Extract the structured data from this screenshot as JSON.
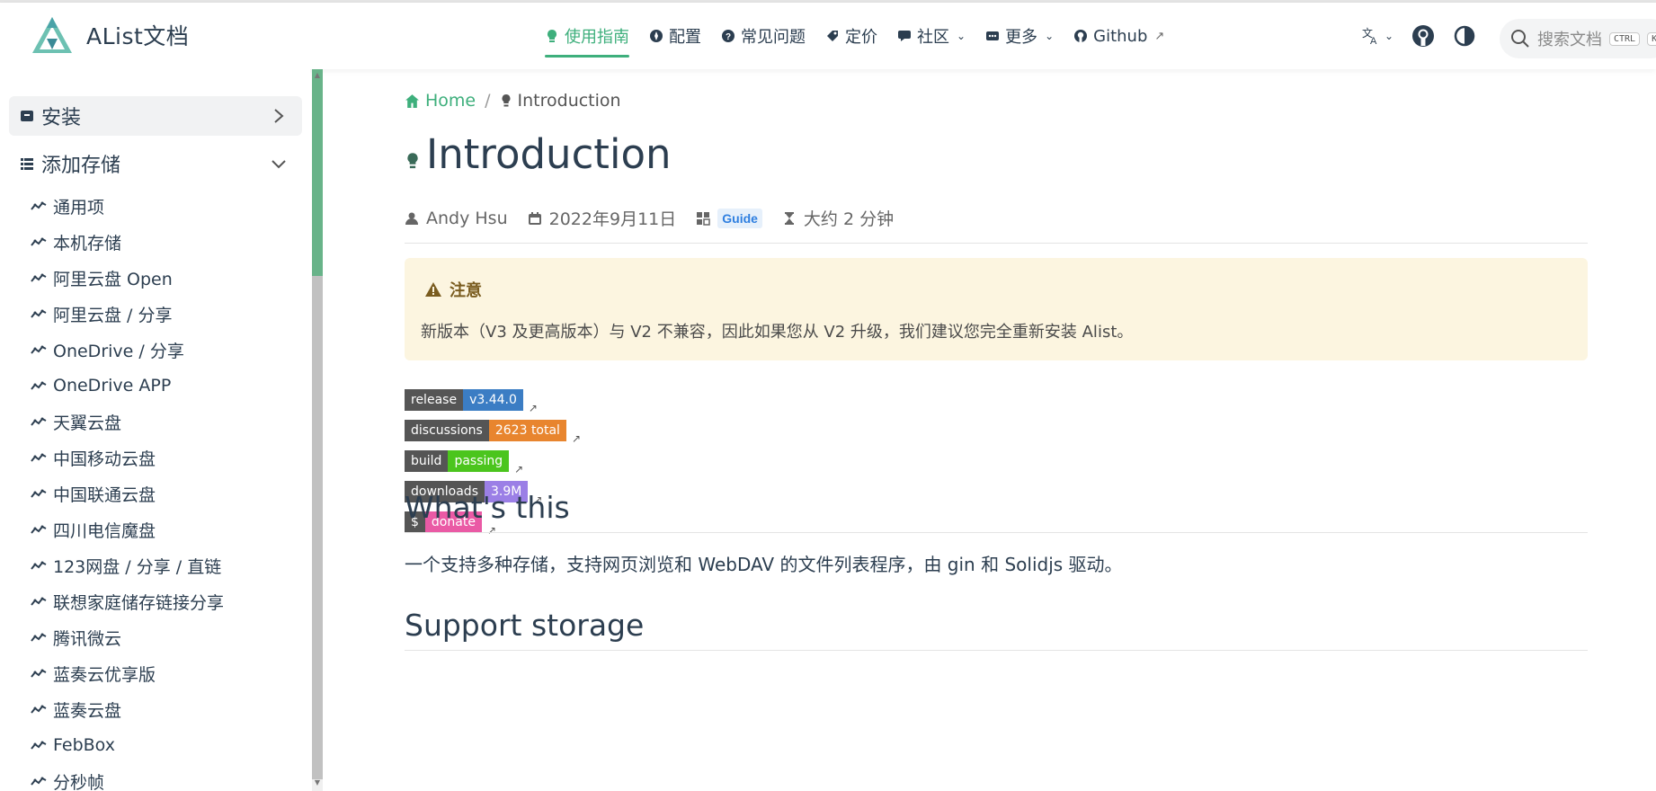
{
  "navbar": {
    "brand": "AList文档",
    "items": [
      {
        "label": "使用指南",
        "icon": "lightbulb-icon",
        "active": true
      },
      {
        "label": "配置",
        "icon": "compass-icon"
      },
      {
        "label": "常见问题",
        "icon": "question-icon"
      },
      {
        "label": "定价",
        "icon": "tag-icon"
      },
      {
        "label": "社区",
        "icon": "chat-icon",
        "dropdown": true
      },
      {
        "label": "更多",
        "icon": "more-icon",
        "dropdown": true
      },
      {
        "label": "Github",
        "icon": "github-icon",
        "external": true
      }
    ],
    "search_placeholder": "搜索文档",
    "search_kbd": "CTRL",
    "search_kbd2": "K"
  },
  "sidebar": {
    "groups": [
      {
        "label": "安装",
        "icon": "archive-icon",
        "expanded": false
      },
      {
        "label": "添加存储",
        "icon": "list-icon",
        "expanded": true
      }
    ],
    "items": [
      "通用项",
      "本机存储",
      "阿里云盘 Open",
      "阿里云盘 / 分享",
      "OneDrive / 分享",
      "OneDrive APP",
      "天翼云盘",
      "中国移动云盘",
      "中国联通云盘",
      "四川电信魔盘",
      "123网盘 / 分享 / 直链",
      "联想家庭储存链接分享",
      "腾讯微云",
      "蓝奏云优享版",
      "蓝奏云盘",
      "FebBox",
      "分秒帧"
    ]
  },
  "breadcrumb": {
    "home": "Home",
    "separator": "/",
    "current": "Introduction"
  },
  "page": {
    "title": "Introduction",
    "author": "Andy Hsu",
    "date": "2022年9月11日",
    "category": "Guide",
    "reading_time": "大约 2 分钟"
  },
  "warning": {
    "title": "注意",
    "text": "新版本（V3 及更高版本）与 V2 不兼容，因此如果您从 V2 升级，我们建议您完全重新安装 Alist。"
  },
  "badges": [
    {
      "label": "release",
      "value": "v3.44.0",
      "color": "#3b7dc4"
    },
    {
      "label": "discussions",
      "value": "2623 total",
      "color": "#e8852e"
    },
    {
      "label": "build",
      "value": "passing",
      "color": "#4bc51d"
    },
    {
      "label": "downloads",
      "value": "3.9M",
      "color": "#9b7fe6"
    },
    {
      "label": "$",
      "value": "donate",
      "color": "#ea5aa5"
    }
  ],
  "sections": [
    {
      "heading": "What's this",
      "text": "一个支持多种存储，支持网页浏览和 WebDAV 的文件列表程序，由 gin 和 Solidjs 驱动。"
    },
    {
      "heading": "Support storage"
    }
  ],
  "colors": {
    "accent": "#3eaf7c",
    "warning_bg": "#fcf5e0"
  }
}
